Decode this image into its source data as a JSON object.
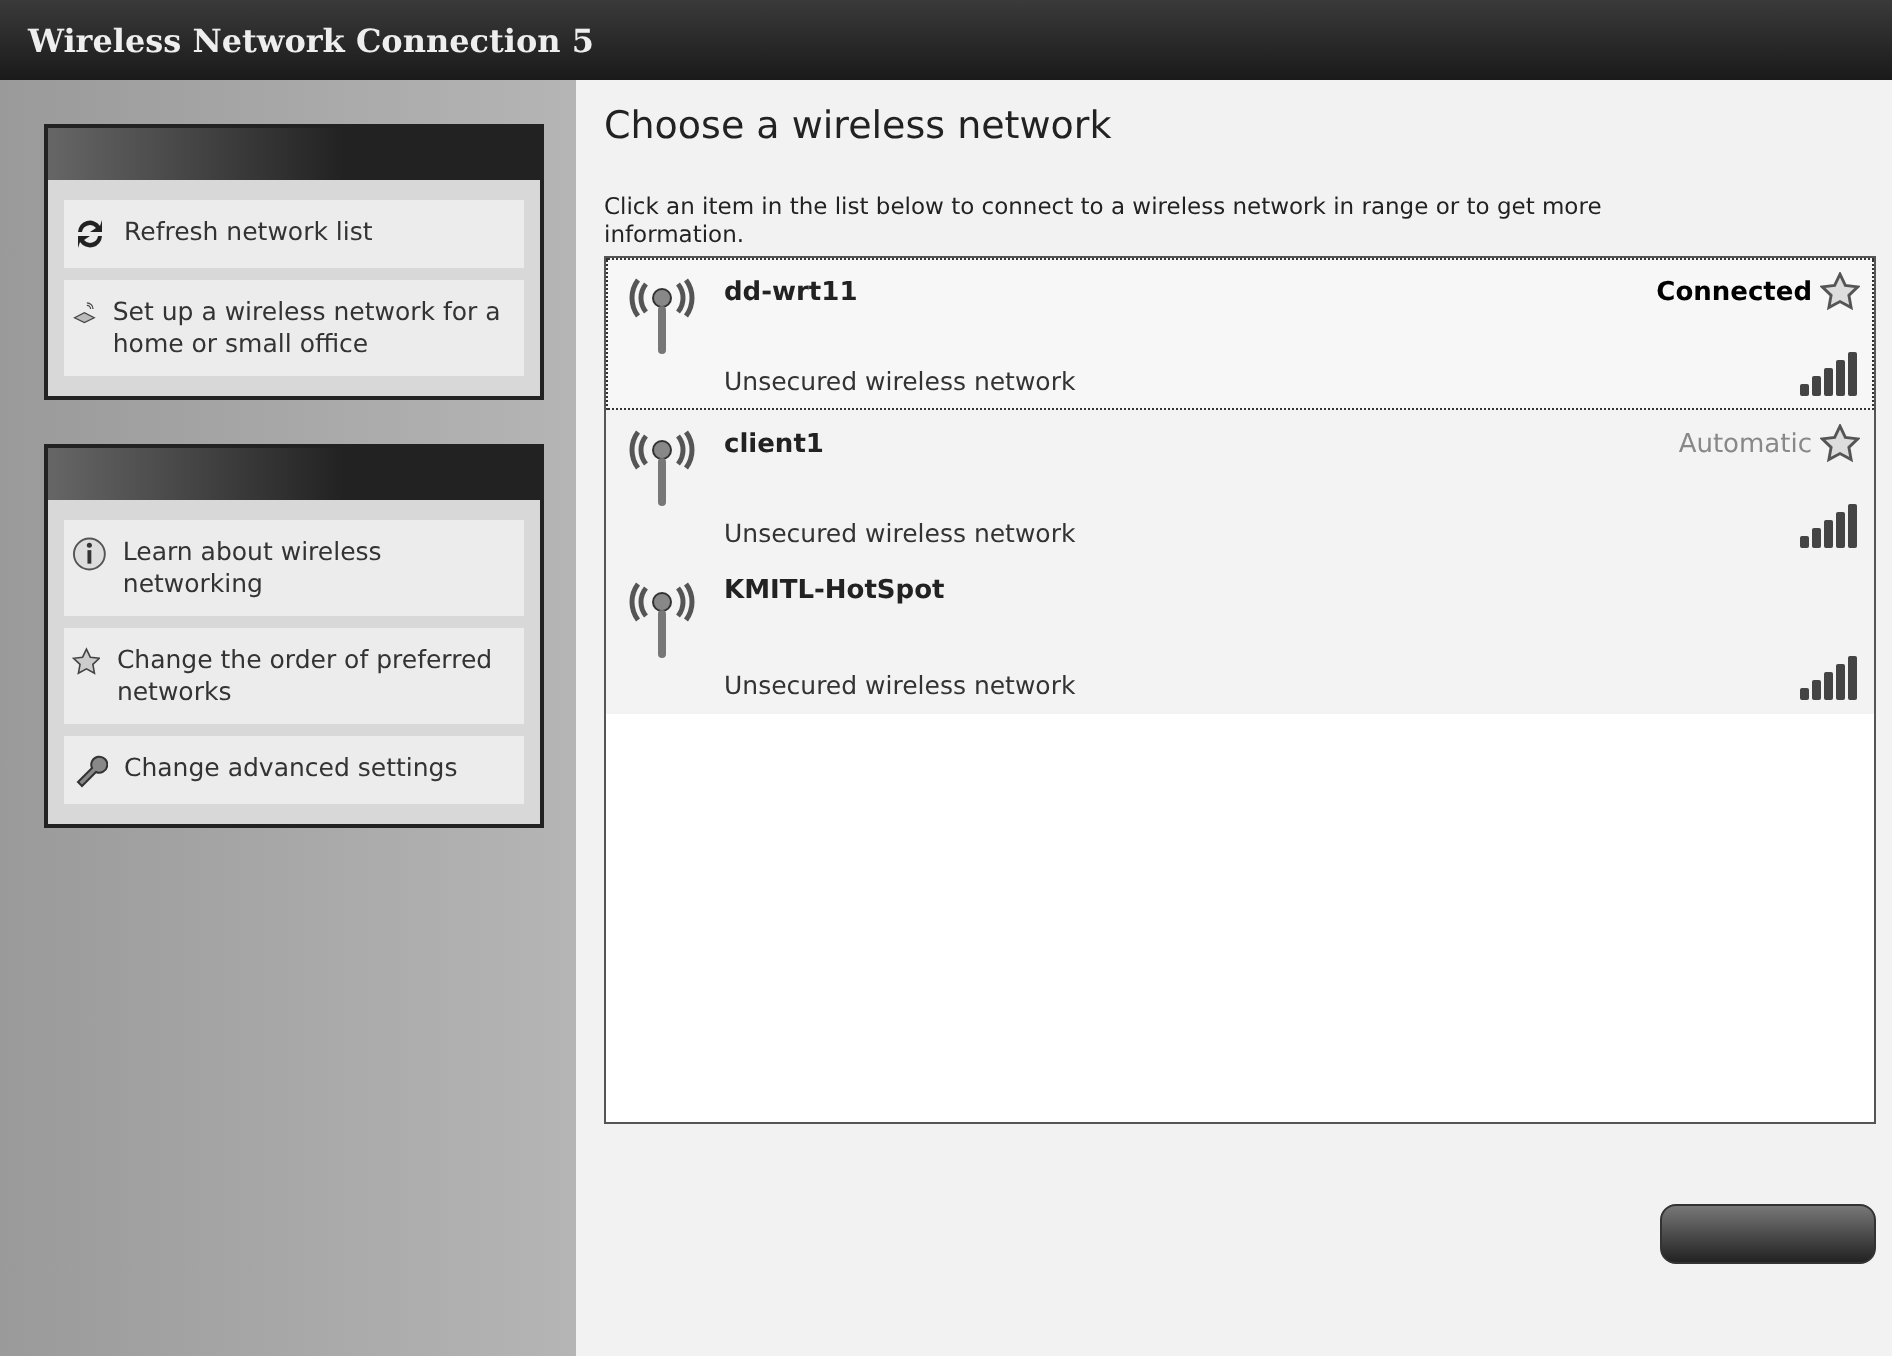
{
  "window": {
    "title": "Wireless Network Connection 5"
  },
  "sidebar": {
    "panels": [
      {
        "items": [
          {
            "label": "Refresh network list",
            "kind": "refresh"
          },
          {
            "label": "Set up a wireless network for a home or small office",
            "kind": "setup"
          }
        ]
      },
      {
        "items": [
          {
            "label": "Learn about wireless networking",
            "kind": "info"
          },
          {
            "label": "Change the order of preferred networks",
            "kind": "star"
          },
          {
            "label": "Change advanced settings",
            "kind": "settings"
          }
        ]
      }
    ]
  },
  "main": {
    "heading": "Choose a wireless network",
    "instructions": "Click an item in the list below to connect to a wireless network in range or to get more information.",
    "networks": [
      {
        "name": "dd-wrt11",
        "security": "Unsecured wireless network",
        "status": "Connected",
        "connected": true,
        "preferred": true,
        "selected": true
      },
      {
        "name": "client1",
        "security": "Unsecured wireless network",
        "status": "Automatic",
        "connected": false,
        "preferred": true,
        "selected": false
      },
      {
        "name": "KMITL-HotSpot",
        "security": "Unsecured wireless network",
        "preferred": false,
        "selected": false
      }
    ]
  }
}
